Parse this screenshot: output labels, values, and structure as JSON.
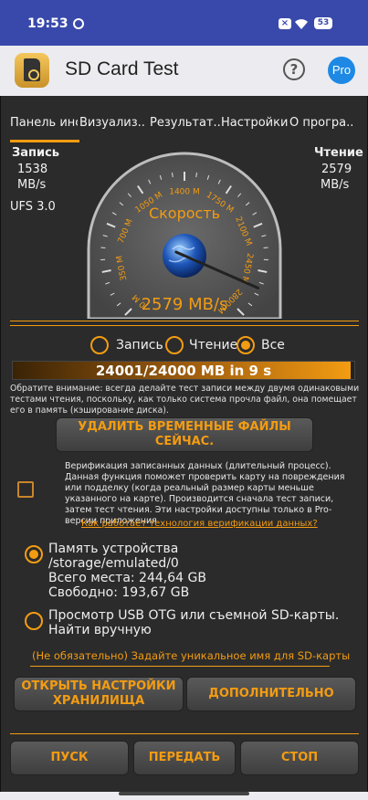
{
  "status_bar": {
    "time": "19:53",
    "battery": "53"
  },
  "app": {
    "title": "SD Card Test",
    "help": "?",
    "pro": "Pro"
  },
  "tabs": [
    {
      "label": "Панель инс"
    },
    {
      "label": "Визуализ.."
    },
    {
      "label": "Результат.."
    },
    {
      "label": "Настройки"
    },
    {
      "label": "О програ.."
    }
  ],
  "write": {
    "label": "Запись",
    "value": "1538",
    "unit": "MB/s",
    "standard": "UFS 3.0"
  },
  "read": {
    "label": "Чтение",
    "value": "2579",
    "unit": "MB/s"
  },
  "gauge": {
    "title": "Скорость",
    "reading": "2579 MB/s",
    "ticks": [
      "0 M",
      "350 M",
      "700 M",
      "1050 M",
      "1400 M",
      "1750 M",
      "2100 M",
      "2450 M",
      "2800 M"
    ],
    "needle_value": 2579,
    "max_value": 2800,
    "accent": "#f39c12"
  },
  "mode": {
    "options": [
      "Запись",
      "Чтение",
      "Все"
    ],
    "selected": 2
  },
  "progress": {
    "text": "24001/24000 MB in 9 s",
    "fraction": 0.99
  },
  "note": "Обратите внимание: всегда делайте тест записи между двумя одинаковыми тестами чтения, поскольку, как только система прочла файл, она помещает его в память (кэширование диска).",
  "delete_button": "УДАЛИТЬ ВРЕМЕННЫЕ ФАЙЛЫ СЕЙЧАС.",
  "verify": {
    "text": "Верификация записанных данных (длительный процесс). Данная функция поможет проверить карту на повреждения или подделку (когда реальный размер карты меньше указанного на карте). Производится сначала тест записи, затем тест чтения. Эти настройки доступны только в Pro-версии приложения",
    "link": "Как работает технология верификации данных?"
  },
  "storage": {
    "device": {
      "name": "Память устройства",
      "path": "/storage/emulated/0",
      "total": "Всего места: 244,64 GB",
      "free": "Свободно: 193,67 GB"
    },
    "usb": {
      "label": "Просмотр USB OTG или съемной SD-карты. Найти вручную"
    }
  },
  "custom_name": "(Не обязательно) Задайте уникальное имя для SD-карты",
  "open_settings": "ОТКРЫТЬ НАСТРОЙКИ ХРАНИЛИЩА",
  "more": "ДОПОЛНИТЕЛЬНО",
  "actions": {
    "start": "ПУСК",
    "send": "ПЕРЕДАТЬ",
    "stop": "СТОП"
  }
}
